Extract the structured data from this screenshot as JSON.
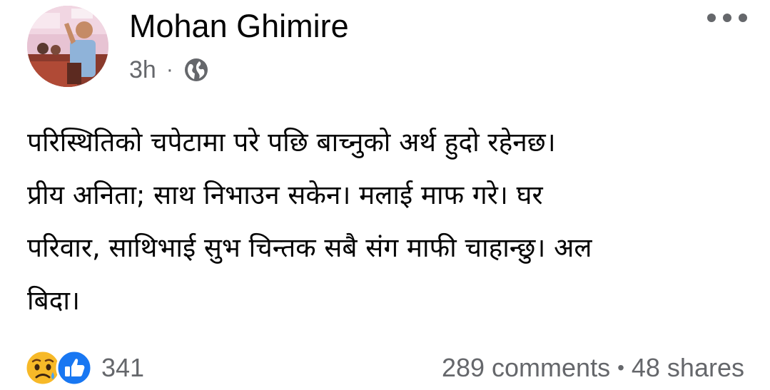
{
  "post": {
    "author": "Mohan Ghimire",
    "time": "3h",
    "separator": "·",
    "privacy_icon": "globe-icon",
    "more_icon": "more-options-icon",
    "text_lines": [
      "परिस्थितिको चपेटामा परे पछि बाच्नुको अर्थ हुदो रहेनछ।",
      "प्रीय अनिता; साथ निभाउन सकेन। मलाई माफ गरे।  घर",
      "परिवार, साथिभाई सुभ चिन्तक सबै संग माफी चाहान्छु। अल",
      "बिदा।"
    ]
  },
  "reactions": {
    "icons": [
      "sad-reaction-icon",
      "like-reaction-icon"
    ],
    "count": "341"
  },
  "engagement": {
    "comments": "289 comments",
    "bullet": "•",
    "shares": "48 shares"
  },
  "colors": {
    "text": "#050505",
    "secondary": "#65676b",
    "like_blue": "#1877f2",
    "sad_yellow": "#f7b928"
  }
}
